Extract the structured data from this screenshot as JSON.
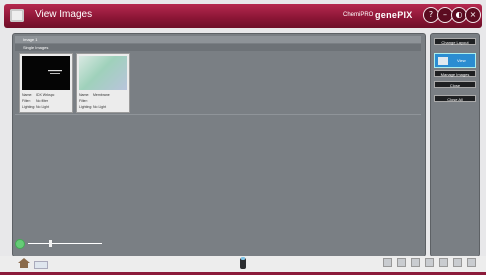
{
  "window": {
    "title": "View Images",
    "brand_small": "ChemiPRO",
    "brand": "genePIX",
    "controls": [
      "?",
      "–",
      "◐",
      "×"
    ]
  },
  "main": {
    "header1": "Image 1",
    "header2": "Single Images",
    "thumbnails": [
      {
        "name_label": "Name:",
        "name": "IDX Wrkspc",
        "filter_label": "Filter:",
        "filter": "No filter",
        "lighting_label": "Lighting:",
        "lighting": "No Light"
      },
      {
        "name_label": "Name:",
        "name": "Membrane",
        "filter_label": "Filter:",
        "filter": "",
        "lighting_label": "Lighting:",
        "lighting": "No Light"
      }
    ]
  },
  "zoom": {
    "level": 0.3
  },
  "side": {
    "change_layout": "Change Layout",
    "view": "View",
    "manage_images": "Manage Images",
    "close": "Close",
    "close_all": "Close All"
  }
}
